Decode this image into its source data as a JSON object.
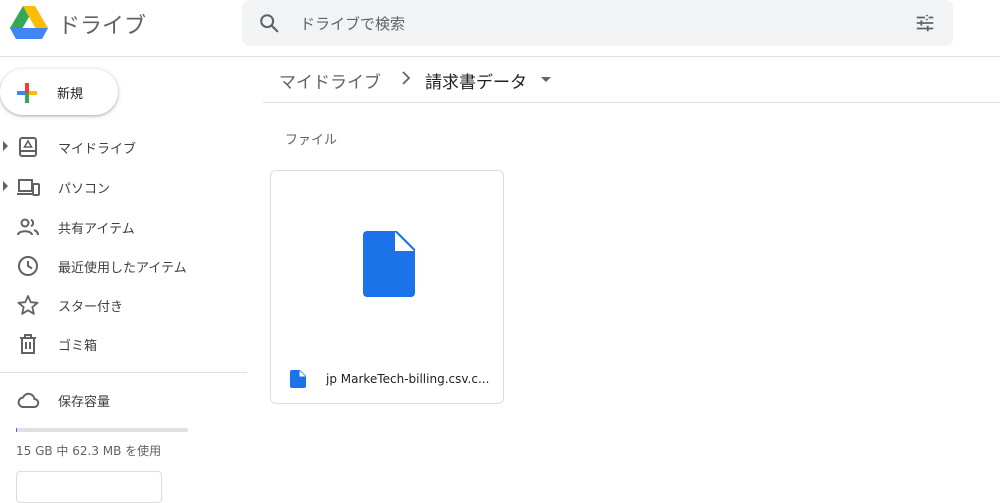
{
  "header": {
    "app_name": "ドライブ",
    "search": {
      "placeholder": "ドライブで検索"
    }
  },
  "sidebar": {
    "new_label": "新規",
    "items": [
      {
        "label": "マイドライブ",
        "icon": "my-drive-icon",
        "expandable": true
      },
      {
        "label": "パソコン",
        "icon": "computers-icon",
        "expandable": true
      },
      {
        "label": "共有アイテム",
        "icon": "shared-people-icon",
        "expandable": false
      },
      {
        "label": "最近使用したアイテム",
        "icon": "clock-icon",
        "expandable": false
      },
      {
        "label": "スター付き",
        "icon": "star-icon",
        "expandable": false
      },
      {
        "label": "ゴミ箱",
        "icon": "trash-icon",
        "expandable": false
      }
    ],
    "storage": {
      "label": "保存容量",
      "usage_text": "15 GB 中 62.3 MB を使用",
      "used_fraction": 0.004
    }
  },
  "breadcrumb": {
    "root": "マイドライブ",
    "current": "請求書データ"
  },
  "content": {
    "section_label": "ファイル",
    "files": [
      {
        "name": "jp MarkeTech-billing.csv.c...",
        "icon": "file-icon",
        "color": "#1a73e8"
      }
    ]
  },
  "colors": {
    "accent": "#1a73e8"
  }
}
